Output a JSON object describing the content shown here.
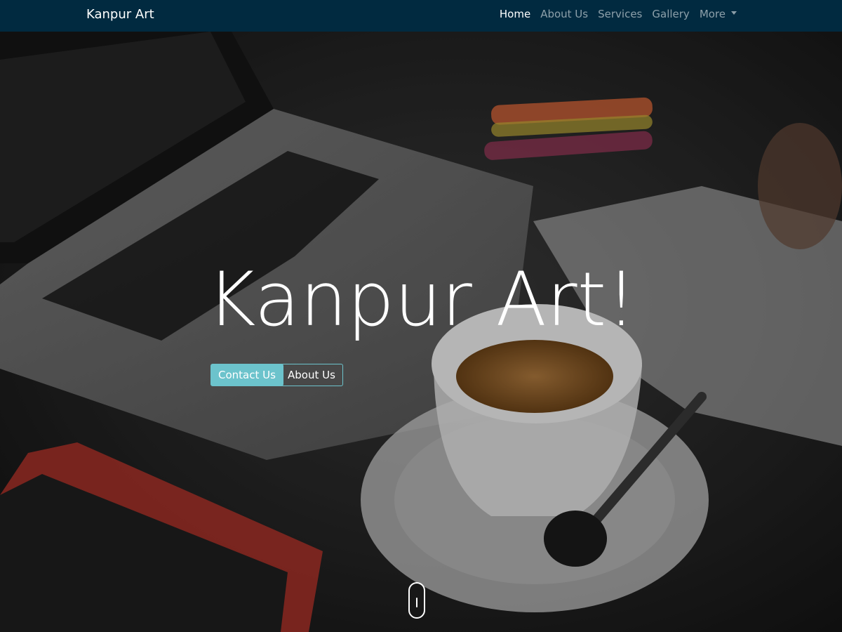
{
  "navbar": {
    "brand": "Kanpur Art",
    "links": [
      "Home",
      "About Us",
      "Services",
      "Gallery",
      "More"
    ]
  },
  "hero": {
    "title": "Kanpur Art!",
    "buttons": {
      "contact": "Contact Us",
      "about": "About Us"
    }
  },
  "colors": {
    "navbar_bg": "#012a40",
    "accent": "#6cc3cc"
  },
  "icons": {
    "dropdown": "chevron-down-icon",
    "scroll": "mouse-scroll-icon"
  }
}
